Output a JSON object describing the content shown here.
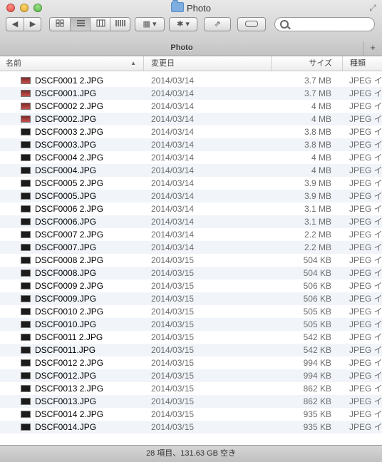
{
  "window": {
    "title": "Photo"
  },
  "toolbar": {
    "back_icon": "chevron-left-icon",
    "forward_icon": "chevron-right-icon",
    "views": [
      "icon-view",
      "list-view",
      "column-view",
      "coverflow-view"
    ],
    "arrange_icon": "arrange-grid-icon",
    "action_icon": "gear-icon",
    "share_icon": "share-icon",
    "tag_icon": "tag-icon",
    "search": {
      "placeholder": "",
      "value": ""
    }
  },
  "tab": {
    "label": "Photo"
  },
  "columns": {
    "name": "名前",
    "date": "変更日",
    "size": "サイズ",
    "kind": "種類"
  },
  "files": [
    {
      "name": "DSCF0001 2.JPG",
      "date": "2014/03/14",
      "size": "3.7 MB",
      "kind": "JPEG イメ"
    },
    {
      "name": "DSCF0001.JPG",
      "date": "2014/03/14",
      "size": "3.7 MB",
      "kind": "JPEG イメ"
    },
    {
      "name": "DSCF0002 2.JPG",
      "date": "2014/03/14",
      "size": "4 MB",
      "kind": "JPEG イメ"
    },
    {
      "name": "DSCF0002.JPG",
      "date": "2014/03/14",
      "size": "4 MB",
      "kind": "JPEG イメ"
    },
    {
      "name": "DSCF0003 2.JPG",
      "date": "2014/03/14",
      "size": "3.8 MB",
      "kind": "JPEG イメ"
    },
    {
      "name": "DSCF0003.JPG",
      "date": "2014/03/14",
      "size": "3.8 MB",
      "kind": "JPEG イメ"
    },
    {
      "name": "DSCF0004 2.JPG",
      "date": "2014/03/14",
      "size": "4 MB",
      "kind": "JPEG イメ"
    },
    {
      "name": "DSCF0004.JPG",
      "date": "2014/03/14",
      "size": "4 MB",
      "kind": "JPEG イメ"
    },
    {
      "name": "DSCF0005 2.JPG",
      "date": "2014/03/14",
      "size": "3.9 MB",
      "kind": "JPEG イメ"
    },
    {
      "name": "DSCF0005.JPG",
      "date": "2014/03/14",
      "size": "3.9 MB",
      "kind": "JPEG イメ"
    },
    {
      "name": "DSCF0006 2.JPG",
      "date": "2014/03/14",
      "size": "3.1 MB",
      "kind": "JPEG イメ"
    },
    {
      "name": "DSCF0006.JPG",
      "date": "2014/03/14",
      "size": "3.1 MB",
      "kind": "JPEG イメ"
    },
    {
      "name": "DSCF0007 2.JPG",
      "date": "2014/03/14",
      "size": "2.2 MB",
      "kind": "JPEG イメ"
    },
    {
      "name": "DSCF0007.JPG",
      "date": "2014/03/14",
      "size": "2.2 MB",
      "kind": "JPEG イメ"
    },
    {
      "name": "DSCF0008 2.JPG",
      "date": "2014/03/15",
      "size": "504 KB",
      "kind": "JPEG イメ"
    },
    {
      "name": "DSCF0008.JPG",
      "date": "2014/03/15",
      "size": "504 KB",
      "kind": "JPEG イメ"
    },
    {
      "name": "DSCF0009 2.JPG",
      "date": "2014/03/15",
      "size": "506 KB",
      "kind": "JPEG イメ"
    },
    {
      "name": "DSCF0009.JPG",
      "date": "2014/03/15",
      "size": "506 KB",
      "kind": "JPEG イメ"
    },
    {
      "name": "DSCF0010 2.JPG",
      "date": "2014/03/15",
      "size": "505 KB",
      "kind": "JPEG イメ"
    },
    {
      "name": "DSCF0010.JPG",
      "date": "2014/03/15",
      "size": "505 KB",
      "kind": "JPEG イメ"
    },
    {
      "name": "DSCF0011 2.JPG",
      "date": "2014/03/15",
      "size": "542 KB",
      "kind": "JPEG イメ"
    },
    {
      "name": "DSCF0011.JPG",
      "date": "2014/03/15",
      "size": "542 KB",
      "kind": "JPEG イメ"
    },
    {
      "name": "DSCF0012 2.JPG",
      "date": "2014/03/15",
      "size": "994 KB",
      "kind": "JPEG イメ"
    },
    {
      "name": "DSCF0012.JPG",
      "date": "2014/03/15",
      "size": "994 KB",
      "kind": "JPEG イメ"
    },
    {
      "name": "DSCF0013 2.JPG",
      "date": "2014/03/15",
      "size": "862 KB",
      "kind": "JPEG イメ"
    },
    {
      "name": "DSCF0013.JPG",
      "date": "2014/03/15",
      "size": "862 KB",
      "kind": "JPEG イメ"
    },
    {
      "name": "DSCF0014 2.JPG",
      "date": "2014/03/15",
      "size": "935 KB",
      "kind": "JPEG イメ"
    },
    {
      "name": "DSCF0014.JPG",
      "date": "2014/03/15",
      "size": "935 KB",
      "kind": "JPEG イメ"
    }
  ],
  "status": {
    "text": "28 項目、131.63 GB 空き"
  }
}
